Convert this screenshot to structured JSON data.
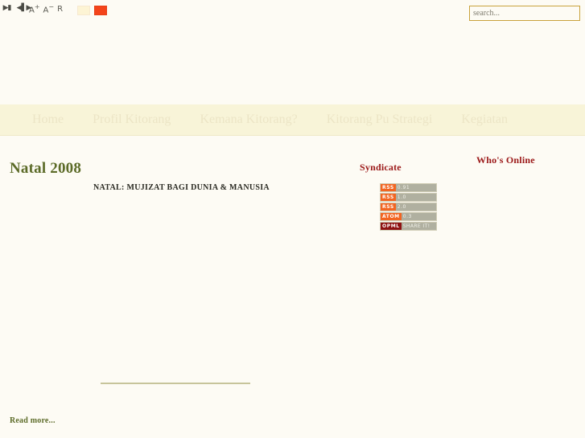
{
  "toolbar": {
    "nav_icons": [
      {
        "name": "skip-back-icon",
        "glyph": "▶▮"
      },
      {
        "name": "play-pause-icon",
        "glyph": "◀▌▶"
      }
    ],
    "font_increase": "A",
    "font_increase_sup": "+",
    "font_decrease": "A",
    "font_decrease_sup": "−",
    "font_reset": "R",
    "swatches": [
      {
        "name": "cream",
        "color": "#fdf4d4"
      },
      {
        "name": "orange",
        "color": "#f4441a"
      }
    ]
  },
  "search": {
    "placeholder": "search...",
    "value": ""
  },
  "nav": {
    "items": [
      {
        "label": "Home"
      },
      {
        "label": "Profil Kitorang"
      },
      {
        "label": "Kemana Kitorang?"
      },
      {
        "label": "Kitorang Pu Strategi"
      },
      {
        "label": "Kegiatan"
      }
    ]
  },
  "main": {
    "page_title": "Natal 2008",
    "article_title": "NATAL:  MUJIZAT BAGI DUNIA & MANUSIA",
    "read_more": "Read more..."
  },
  "sidebar": {
    "syndicate": {
      "title": "Syndicate",
      "feeds": [
        {
          "tag": "RSS",
          "version": "0.91"
        },
        {
          "tag": "RSS",
          "version": "1.0"
        },
        {
          "tag": "RSS",
          "version": "2.0"
        },
        {
          "tag": "ATOM",
          "version": "0.3"
        },
        {
          "tag": "OPML",
          "version": "SHARE IT!"
        }
      ]
    },
    "whos_online": {
      "title": "Who's Online"
    }
  },
  "colors": {
    "background": "#fdfbf4",
    "nav_band": "#f8f4d8",
    "accent_red": "#9b1818",
    "accent_olive": "#5c6b28",
    "feed_orange": "#f26522",
    "feed_opml": "#8e1212",
    "search_border": "#c9a23c"
  }
}
